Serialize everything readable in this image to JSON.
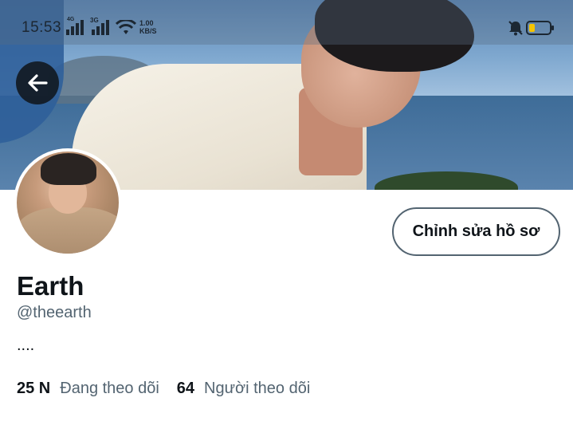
{
  "status_bar": {
    "time": "15:53",
    "network_1": "4G",
    "network_2": "3G",
    "speed_value": "1.00",
    "speed_unit": "KB/S",
    "icons": [
      "signal-icon",
      "signal-icon",
      "wifi-icon",
      "mute-icon",
      "battery-icon"
    ],
    "battery_color": "#f5c400"
  },
  "header": {
    "back_icon": "arrow-left-icon"
  },
  "profile": {
    "edit_button_label": "Chỉnh sửa hồ sơ",
    "display_name": "Earth",
    "handle": "@theearth",
    "bio": "....",
    "following_count": "25 N",
    "following_label": "Đang theo dõi",
    "followers_count": "64",
    "followers_label": "Người theo dõi"
  },
  "colors": {
    "primary_text": "#0f1419",
    "secondary_text": "#536471",
    "button_border": "#536471"
  }
}
